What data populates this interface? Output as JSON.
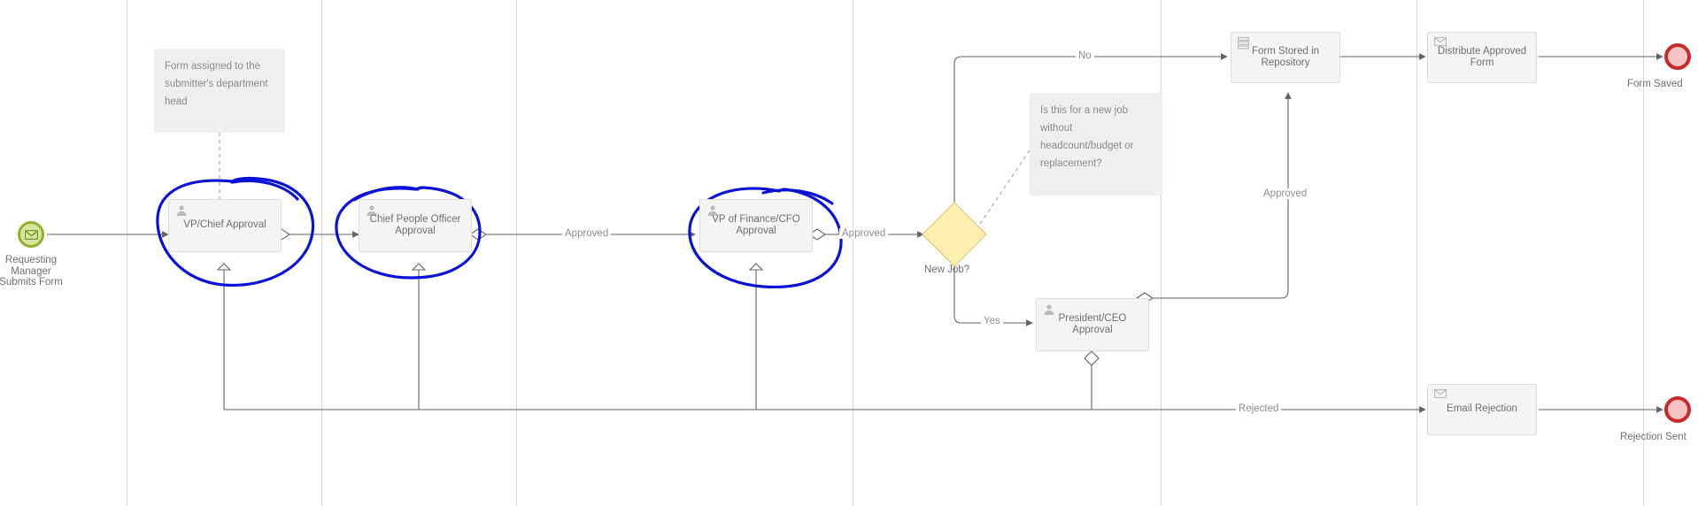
{
  "diagram": {
    "type": "bpmn-workflow",
    "title": "Approval Workflow",
    "background": "#ffffff",
    "colors": {
      "task_fill": "#f4f4f4",
      "task_stroke": "#dcdcdc",
      "gateway_fill": "#fdefb0",
      "gateway_stroke": "#d6c26a",
      "start_event_fill": "#d6e5a0",
      "start_event_stroke": "#93ad2c",
      "end_event_fill": "#f7c3c3",
      "end_event_stroke": "#c72a2a",
      "connector": "#63625f",
      "annotation_fill": "#efefef",
      "text": "#6e6e6e",
      "ink_highlight": "#0a12d8",
      "lane_divider": "#d8d8d8"
    }
  },
  "events": [
    {
      "id": "start",
      "kind": "start-message-event",
      "icon": "envelope-icon",
      "label": "Requesting\nManager\nSubmits Form"
    },
    {
      "id": "end_form_saved",
      "kind": "end-event",
      "label": "Form Saved"
    },
    {
      "id": "end_rejection_sent",
      "kind": "end-event",
      "label": "Rejection Sent"
    }
  ],
  "tasks": [
    {
      "id": "vp_chief",
      "label": "VP/Chief Approval",
      "icon": "user-icon",
      "highlighted": true
    },
    {
      "id": "cpo",
      "label": "Chief People Officer Approval",
      "icon": "user-icon",
      "highlighted": true
    },
    {
      "id": "cfo",
      "label": "VP of Finance/CFO Approval",
      "icon": "user-icon",
      "highlighted": true
    },
    {
      "id": "ceo",
      "label": "President/CEO Approval",
      "icon": "user-icon",
      "highlighted": false
    },
    {
      "id": "store_form",
      "label": "Form Stored in Repository",
      "icon": "service-icon",
      "highlighted": false
    },
    {
      "id": "distribute",
      "label": "Distribute Approved Form",
      "icon": "envelope-icon",
      "highlighted": false
    },
    {
      "id": "email_reject",
      "label": "Email Rejection",
      "icon": "envelope-icon",
      "highlighted": false
    }
  ],
  "gateways": [
    {
      "id": "new_job",
      "label": "New Job?",
      "kind": "exclusive-gateway"
    }
  ],
  "annotations": [
    {
      "id": "note_assignment",
      "text": "Form assigned to the submitter's department head"
    },
    {
      "id": "note_newjob",
      "text": "Is this for a new job without headcount/budget or replacement?"
    }
  ],
  "flow_labels": [
    {
      "id": "flow_cpo_approved",
      "text": "Approved"
    },
    {
      "id": "flow_cfo_approved",
      "text": "Approved"
    },
    {
      "id": "flow_gateway_no",
      "text": "No"
    },
    {
      "id": "flow_gateway_yes",
      "text": "Yes"
    },
    {
      "id": "flow_ceo_approved",
      "text": "Approved"
    },
    {
      "id": "flow_rejected",
      "text": "Rejected"
    }
  ]
}
